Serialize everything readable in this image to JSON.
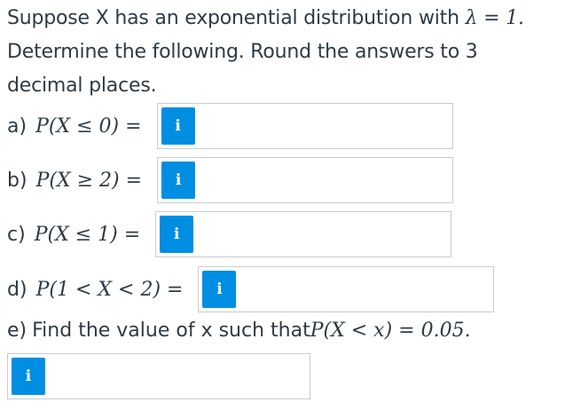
{
  "question": {
    "line1_prefix": "Suppose X has an exponential distribution with ",
    "line1_math": "λ = 1.",
    "line2": "Determine the following. Round the answers to 3",
    "line3": "decimal places."
  },
  "parts": [
    {
      "letter": "a)",
      "expr": "P(X ≤ 0) =",
      "input_value": ""
    },
    {
      "letter": "b)",
      "expr": "P(X ≥ 2) =",
      "input_value": ""
    },
    {
      "letter": "c)",
      "expr": "P(X ≤ 1) =",
      "input_value": ""
    },
    {
      "letter": "d)",
      "expr": "P(1 < X < 2) =",
      "input_value": ""
    },
    {
      "letter": "e)",
      "text": "Find the value of x such that ",
      "expr": "P(X < x) = 0.05.",
      "input_value": ""
    }
  ],
  "info_button": {
    "icon": "info-icon",
    "glyph": "i",
    "color": "#008ee2"
  }
}
